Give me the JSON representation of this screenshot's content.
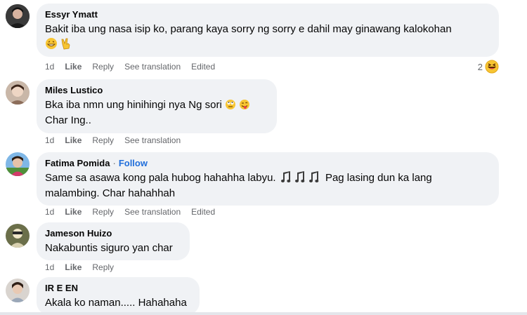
{
  "comments": [
    {
      "author": "Essyr Ymatt",
      "text": "Bakit iba ung nasa isip ko, parang kaya sorry ng sorry e dahil may ginawang kalokohan",
      "time": "1d",
      "like": "Like",
      "reply": "Reply",
      "translate": "See translation",
      "edited": "Edited",
      "reaction_count": "2"
    },
    {
      "author": "Miles Lustico",
      "text_line1": "Bka iba nmn ung hinihingi nya Ng sori",
      "text_line2": "Char Ing..",
      "time": "1d",
      "like": "Like",
      "reply": "Reply",
      "translate": "See translation"
    },
    {
      "author": "Fatima Pomida",
      "follow": "Follow",
      "text_line1": "Same sa asawa kong pala hubog hahahha labyu.",
      "text_line1b": "Pag lasing dun ka lang",
      "text_line2": "malambing. Char hahahhah",
      "time": "1d",
      "like": "Like",
      "reply": "Reply",
      "translate": "See translation",
      "edited": "Edited"
    },
    {
      "author": "Jameson Huizo",
      "text": "Nakabuntis siguro yan char",
      "time": "1d",
      "like": "Like",
      "reply": "Reply"
    },
    {
      "author": "IR E EN",
      "text": "Akala ko naman..... Hahahaha"
    }
  ],
  "colors": {
    "bubble": "#f0f2f5",
    "meta": "#65676b",
    "follow": "#216fdb"
  }
}
